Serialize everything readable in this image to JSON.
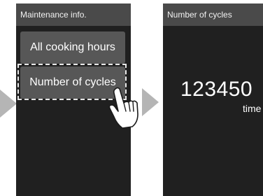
{
  "screen_menu": {
    "title": "Maintenance info.",
    "buttons": [
      {
        "label": "All cooking hours"
      },
      {
        "label": "Number of cycles",
        "selected": true
      }
    ]
  },
  "screen_result": {
    "title": "Number of cycles",
    "count": "123450",
    "unit": "time"
  },
  "colors": {
    "screen_bg": "#202020",
    "titlebar_bg": "#4a4a4a",
    "button_bg": "#575757",
    "arrow": "#b5b5b5",
    "text": "#ffffff"
  },
  "icons": [
    "pointing-hand-icon",
    "chevron-right-arrow-icon"
  ]
}
